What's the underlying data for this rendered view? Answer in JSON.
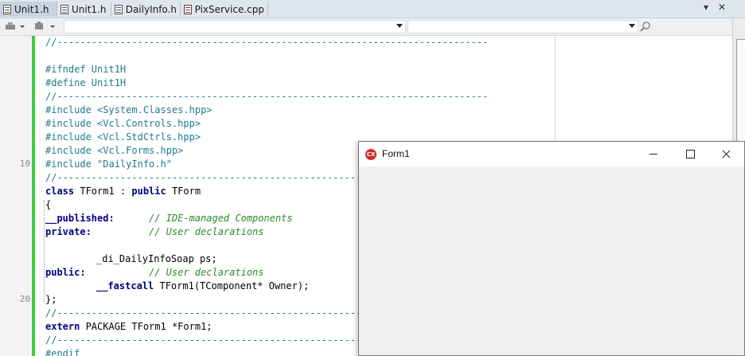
{
  "tabs": [
    {
      "label": "Unit1.h",
      "active": true
    },
    {
      "label": "Unit1.h",
      "active": false
    },
    {
      "label": "DailyInfo.h",
      "active": false
    },
    {
      "label": "PixService.cpp",
      "active": false
    }
  ],
  "tab_controls": {
    "dropdown_glyph": "▾",
    "close_glyph": "✕"
  },
  "editor": {
    "line_numbers": {
      "ln10": "10",
      "ln20": "20"
    },
    "lines": {
      "l1": "//---------------------------------------------------------------------------",
      "l3": "#ifndef Unit1H",
      "l4": "#define Unit1H",
      "l5": "//---------------------------------------------------------------------------",
      "l6": "#include <System.Classes.hpp>",
      "l7": "#include <Vcl.Controls.hpp>",
      "l8": "#include <Vcl.StdCtrls.hpp>",
      "l9": "#include <Vcl.Forms.hpp>",
      "l10": "#include \"DailyInfo.h\"",
      "l11": "//---------------------------------------------------------------------------",
      "l12_kw1": "class",
      "l12_mid": " TForm1 : ",
      "l12_kw2": "public",
      "l12_end": " TForm",
      "l13": "{",
      "l14_kw": "__published:",
      "l14_cm": "// IDE-managed Components",
      "l15_kw": "private:",
      "l15_cm": "// User declarations",
      "l17": "_di_DailyInfoSoap ps;",
      "l18_kw": "public:",
      "l18_cm": "// User declarations",
      "l19_kw": "__fastcall",
      "l19_tx": " TForm1(TComponent* Owner);",
      "l20": "};",
      "l21": "//---------------------------------------------------------------------------",
      "l22_kw": "extern",
      "l22_tx": " PACKAGE TForm1 *Form1;",
      "l23": "//---------------------------------------------------------------------------",
      "l24": "#endif"
    }
  },
  "form_window": {
    "title": "Form1",
    "icon_text": "CX"
  },
  "colors": {
    "changebar": "#3cd03c",
    "preprocessor": "#1f7b8a",
    "keyword": "#000080",
    "comment": "#2d8a2d"
  }
}
